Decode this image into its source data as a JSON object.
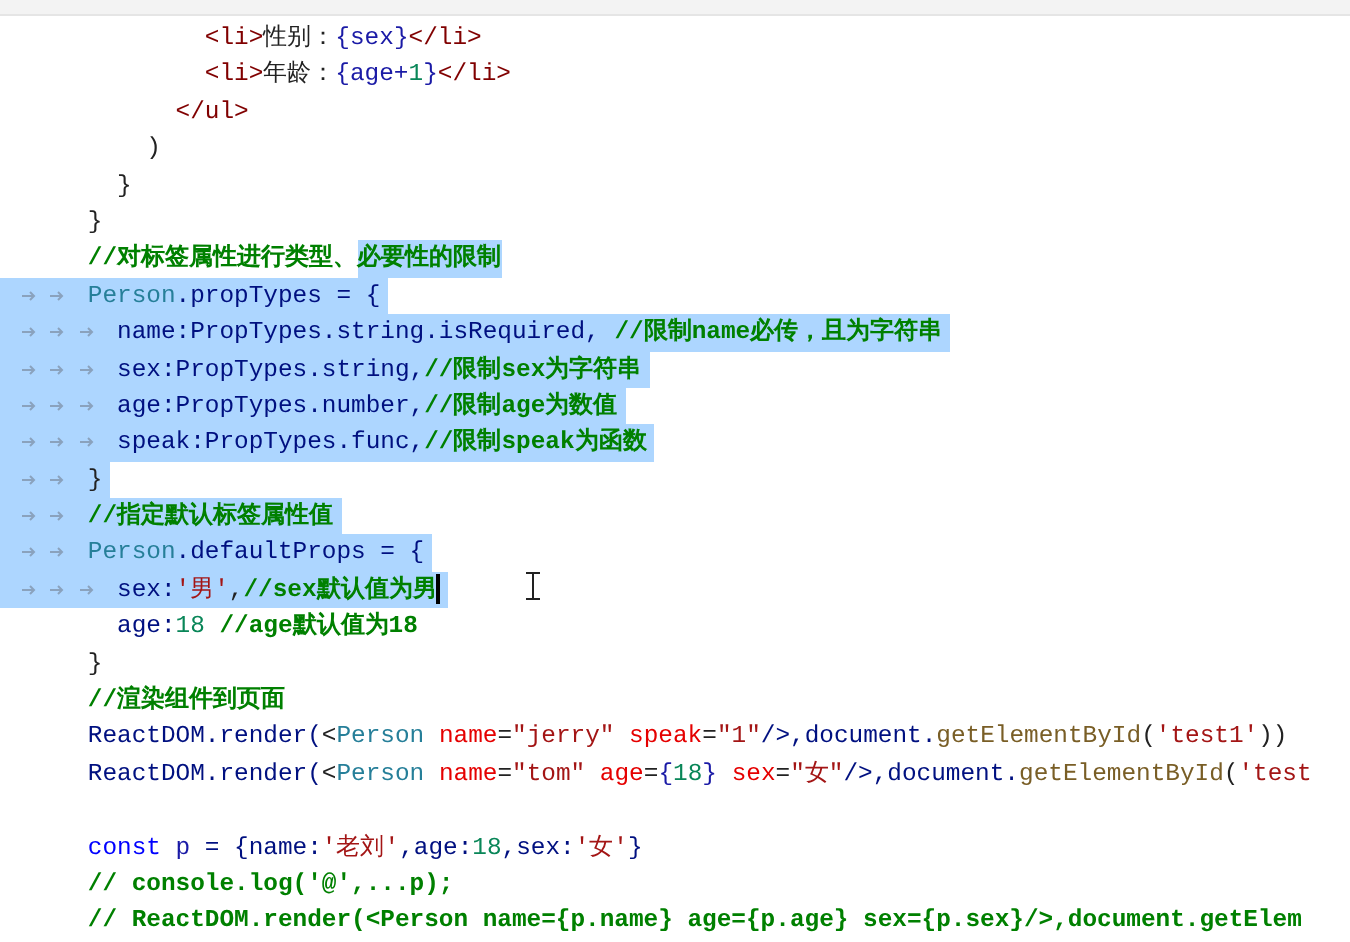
{
  "editor": {
    "lines": [
      {
        "selected": false,
        "tokens": [
          {
            "text": "              <li>",
            "kind": "tag"
          },
          {
            "text": "性别：",
            "kind": "plain"
          },
          {
            "text": "{",
            "kind": "brace"
          },
          {
            "text": "sex",
            "kind": "var"
          },
          {
            "text": "}",
            "kind": "brace"
          },
          {
            "text": "</li>",
            "kind": "tag"
          }
        ]
      },
      {
        "selected": false,
        "tokens": [
          {
            "text": "              <li>",
            "kind": "tag"
          },
          {
            "text": "年龄：",
            "kind": "plain"
          },
          {
            "text": "{",
            "kind": "brace"
          },
          {
            "text": "age+",
            "kind": "var"
          },
          {
            "text": "1",
            "kind": "number"
          },
          {
            "text": "}",
            "kind": "brace"
          },
          {
            "text": "</li>",
            "kind": "tag"
          }
        ]
      },
      {
        "selected": false,
        "tokens": [
          {
            "text": "            </ul>",
            "kind": "tag"
          }
        ]
      },
      {
        "selected": false,
        "tokens": [
          {
            "text": "          )",
            "kind": "plain"
          }
        ]
      },
      {
        "selected": false,
        "tokens": [
          {
            "text": "        }",
            "kind": "plain"
          }
        ]
      },
      {
        "selected": false,
        "tokens": [
          {
            "text": "      }",
            "kind": "plain"
          }
        ]
      },
      {
        "selected": false,
        "tokens": [
          {
            "text": "      //对标签属性进行类型、",
            "kind": "comment",
            "selected": false
          },
          {
            "text": "必要性的限制",
            "kind": "comment",
            "selected": true
          }
        ]
      },
      {
        "selected": true,
        "tokens": [
          {
            "text": "      Person",
            "kind": "cls"
          },
          {
            "text": ".propTypes = {",
            "kind": "prop"
          }
        ]
      },
      {
        "selected": true,
        "tokens": [
          {
            "text": "        name:PropTypes.string.isRequired, ",
            "kind": "prop"
          },
          {
            "text": "//限制name必传，且为字符串",
            "kind": "comment"
          }
        ]
      },
      {
        "selected": true,
        "tokens": [
          {
            "text": "        sex:PropTypes.string,",
            "kind": "prop"
          },
          {
            "text": "//限制sex为字符串",
            "kind": "comment"
          }
        ]
      },
      {
        "selected": true,
        "tokens": [
          {
            "text": "        age:PropTypes.number,",
            "kind": "prop"
          },
          {
            "text": "//限制age为数值",
            "kind": "comment"
          }
        ]
      },
      {
        "selected": true,
        "tokens": [
          {
            "text": "        speak:PropTypes.func,",
            "kind": "prop"
          },
          {
            "text": "//限制speak为函数",
            "kind": "comment"
          }
        ]
      },
      {
        "selected": true,
        "tokens": [
          {
            "text": "      }",
            "kind": "plain"
          }
        ]
      },
      {
        "selected": true,
        "tokens": [
          {
            "text": "      //指定默认标签属性值",
            "kind": "comment"
          }
        ]
      },
      {
        "selected": true,
        "tokens": [
          {
            "text": "      Person",
            "kind": "cls"
          },
          {
            "text": ".defaultProps = {",
            "kind": "prop"
          }
        ]
      },
      {
        "selected": true,
        "cursor": true,
        "tokens": [
          {
            "text": "        sex:",
            "kind": "prop"
          },
          {
            "text": "'男'",
            "kind": "string"
          },
          {
            "text": ",",
            "kind": "plain"
          },
          {
            "text": "//sex默认值为男",
            "kind": "comment"
          }
        ]
      },
      {
        "selected": false,
        "tokens": [
          {
            "text": "        age:",
            "kind": "prop"
          },
          {
            "text": "18",
            "kind": "number"
          },
          {
            "text": " //age默认值为18",
            "kind": "comment"
          }
        ]
      },
      {
        "selected": false,
        "tokens": [
          {
            "text": "      }",
            "kind": "plain"
          }
        ]
      },
      {
        "selected": false,
        "tokens": [
          {
            "text": "      //渲染组件到页面",
            "kind": "comment"
          }
        ]
      },
      {
        "selected": false,
        "tokens": [
          {
            "text": "      ReactDOM.render(",
            "kind": "prop"
          },
          {
            "text": "<",
            "kind": "plain"
          },
          {
            "text": "Person",
            "kind": "cls"
          },
          {
            "text": " name",
            "kind": "attr"
          },
          {
            "text": "=",
            "kind": "plain"
          },
          {
            "text": "\"jerry\"",
            "kind": "string"
          },
          {
            "text": " speak",
            "kind": "attr"
          },
          {
            "text": "=",
            "kind": "plain"
          },
          {
            "text": "\"1\"",
            "kind": "string"
          },
          {
            "text": "/>,document.",
            "kind": "prop"
          },
          {
            "text": "getElementById",
            "kind": "func"
          },
          {
            "text": "(",
            "kind": "plain"
          },
          {
            "text": "'test1'",
            "kind": "string"
          },
          {
            "text": "))",
            "kind": "plain"
          }
        ]
      },
      {
        "selected": false,
        "tokens": [
          {
            "text": "      ReactDOM.render(",
            "kind": "prop"
          },
          {
            "text": "<",
            "kind": "plain"
          },
          {
            "text": "Person",
            "kind": "cls"
          },
          {
            "text": " name",
            "kind": "attr"
          },
          {
            "text": "=",
            "kind": "plain"
          },
          {
            "text": "\"tom\"",
            "kind": "string"
          },
          {
            "text": " age",
            "kind": "attr"
          },
          {
            "text": "=",
            "kind": "plain"
          },
          {
            "text": "{",
            "kind": "brace"
          },
          {
            "text": "18",
            "kind": "number"
          },
          {
            "text": "}",
            "kind": "brace"
          },
          {
            "text": " sex",
            "kind": "attr"
          },
          {
            "text": "=",
            "kind": "plain"
          },
          {
            "text": "\"女\"",
            "kind": "string"
          },
          {
            "text": "/>,document.",
            "kind": "prop"
          },
          {
            "text": "getElementById",
            "kind": "func"
          },
          {
            "text": "(",
            "kind": "plain"
          },
          {
            "text": "'test",
            "kind": "string"
          }
        ]
      },
      {
        "selected": false
      },
      {
        "selected": false,
        "tokens": [
          {
            "text": "      const",
            "kind": "keyword"
          },
          {
            "text": " p",
            "kind": "var"
          },
          {
            "text": " = {name:",
            "kind": "prop"
          },
          {
            "text": "'老刘'",
            "kind": "string"
          },
          {
            "text": ",age:",
            "kind": "prop"
          },
          {
            "text": "18",
            "kind": "number"
          },
          {
            "text": ",sex:",
            "kind": "prop"
          },
          {
            "text": "'女'",
            "kind": "string"
          },
          {
            "text": "}",
            "kind": "prop"
          }
        ]
      },
      {
        "selected": false,
        "tokens": [
          {
            "text": "      // console.log('@',...p);",
            "kind": "comment"
          }
        ]
      },
      {
        "selected": false,
        "tokens": [
          {
            "text": "      // ReactDOM.render(<Person name={p.name} age={p.age} sex={p.sex}/>,document.getElem",
            "kind": "comment"
          }
        ]
      }
    ]
  }
}
